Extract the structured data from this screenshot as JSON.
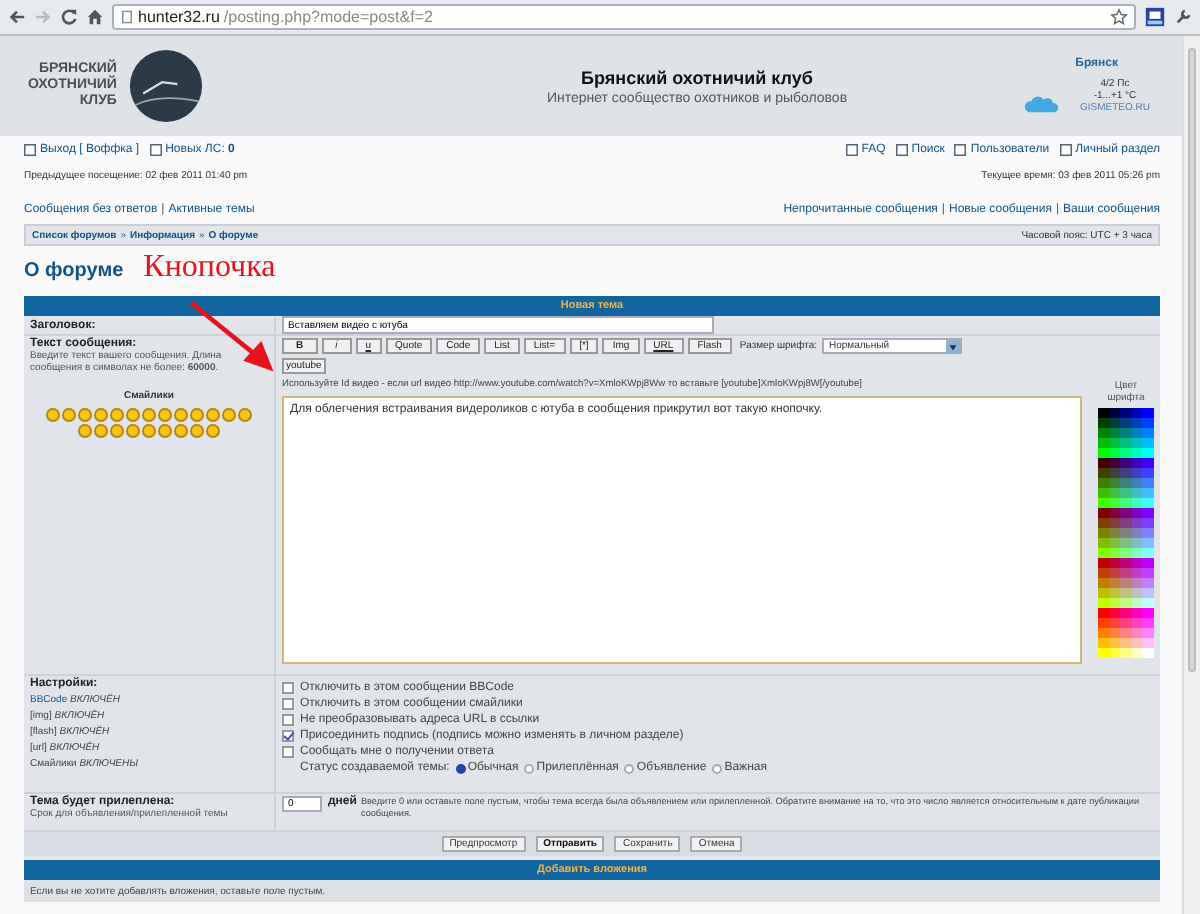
{
  "browser": {
    "host": "hunter32.ru",
    "path": "/posting.php?mode=post&f=2"
  },
  "header": {
    "logo_lines": [
      "БРЯНСКИЙ",
      "ОХОТНИЧИЙ",
      "КЛУБ"
    ],
    "title": "Брянский охотничий клуб",
    "subtitle": "Интернет сообщество охотников и рыболовов"
  },
  "weather": {
    "city": "Брянск",
    "condition": "4/2 Пс",
    "temperature": "-1...+1 °C",
    "source": "GISMETEO.RU"
  },
  "nav": {
    "left": [
      "Выход [ Воффка ]",
      "Новых ЛС: **0**"
    ],
    "right": [
      "FAQ",
      "Поиск",
      "Пользователи",
      "Личный раздел"
    ]
  },
  "visits": {
    "previous": "Предыдущее посещение: 02 фев 2011 01:40 pm",
    "current": "Текущее время: 03 фев 2011 05:26 pm"
  },
  "quick_links": {
    "separator": "|",
    "left": [
      "Сообщения без ответов",
      "Активные темы"
    ],
    "right": [
      "Непрочитанные сообщения",
      "Новые сообщения",
      "Ваши сообщения"
    ]
  },
  "breadcrumbs": {
    "separator": "»",
    "items": [
      "Список форумов",
      "Информация",
      "О форуме"
    ],
    "timezone": "Часовой пояс: UTC + 3 часа"
  },
  "page": {
    "title": "О форуме",
    "annotation": "Кнопочка"
  },
  "form": {
    "title": "Новая тема",
    "subject": {
      "label": "Заголовок:",
      "value": "Вставляем видео с ютуба"
    },
    "message": {
      "label": "Текст сообщения:",
      "description": "Введите текст вашего сообщения. Длина сообщения в символах не более: **60000**.",
      "smilies_title": "Смайлики",
      "toolbar": [
        {
          "label": "B",
          "kind": "bold"
        },
        {
          "label": "i",
          "kind": "italic"
        },
        {
          "label": "u",
          "kind": "underline"
        },
        {
          "label": "Quote",
          "kind": "plain"
        },
        {
          "label": "Code",
          "kind": "plain"
        },
        {
          "label": "List",
          "kind": "plain"
        },
        {
          "label": "List=",
          "kind": "plain"
        },
        {
          "label": "[*]",
          "kind": "plain"
        },
        {
          "label": "Img",
          "kind": "plain"
        },
        {
          "label": "URL",
          "kind": "underline"
        },
        {
          "label": "Flash",
          "kind": "plain"
        }
      ],
      "font_size_label": "Размер шрифта:",
      "font_size_value": "Нормальный",
      "extra_button": "youtube",
      "help": "Используйте Id видео - если url видео http://www.youtube.com/watch?v=XmloKWpj8Ww то вставьте [youtube]XmloKWpj8W[/youtube]",
      "text": "Для облегчения встраивания видероликов с ютуба в сообщения прикрутил вот такую кнопочку.",
      "palette_title": "Цвет шрифта"
    },
    "settings": {
      "label": "Настройки:",
      "items": [
        {
          "name": "BBCode",
          "state": "ВКЛЮЧЁН",
          "link": true
        },
        {
          "name": "[img]",
          "state": "ВКЛЮЧЁН",
          "link": false
        },
        {
          "name": "[flash]",
          "state": "ВКЛЮЧЁН",
          "link": false
        },
        {
          "name": "[url]",
          "state": "ВКЛЮЧЁН",
          "link": false
        },
        {
          "name": "Смайлики",
          "state": "ВКЛЮЧЕНЫ",
          "link": false
        }
      ],
      "checkboxes": [
        {
          "label": "Отключить в этом сообщении BBCode",
          "checked": false
        },
        {
          "label": "Отключить в этом сообщении смайлики",
          "checked": false
        },
        {
          "label": "Не преобразовывать адреса URL в ссылки",
          "checked": false
        },
        {
          "label": "Присоединить подпись (подпись можно изменять в личном разделе)",
          "checked": true
        },
        {
          "label": "Сообщать мне о получении ответа",
          "checked": false
        }
      ],
      "status_label": "Статус создаваемой темы:",
      "radios": [
        {
          "label": "Обычная",
          "selected": true
        },
        {
          "label": "Прилеплённая",
          "selected": false
        },
        {
          "label": "Объявление",
          "selected": false
        },
        {
          "label": "Важная",
          "selected": false
        }
      ]
    },
    "sticky": {
      "label": "Тема будет прилеплена:",
      "sublabel": "Срок для объявления/прилепленной темы",
      "value": "0",
      "unit": "дней",
      "help": "Введите 0 или оставьте поле пустым, чтобы тема всегда была объявлением или прилепленной. Обратите внимание на то, что это число является относительным к дате публикации сообщения."
    },
    "buttons": [
      {
        "label": "Предпросмотр",
        "primary": false
      },
      {
        "label": "Отправить",
        "primary": true
      },
      {
        "label": "Сохранить",
        "primary": false
      },
      {
        "label": "Отмена",
        "primary": false
      }
    ],
    "attachments": {
      "title": "Добавить вложения",
      "note": "Если вы не хотите добавлять вложения, оставьте поле пустым."
    }
  }
}
